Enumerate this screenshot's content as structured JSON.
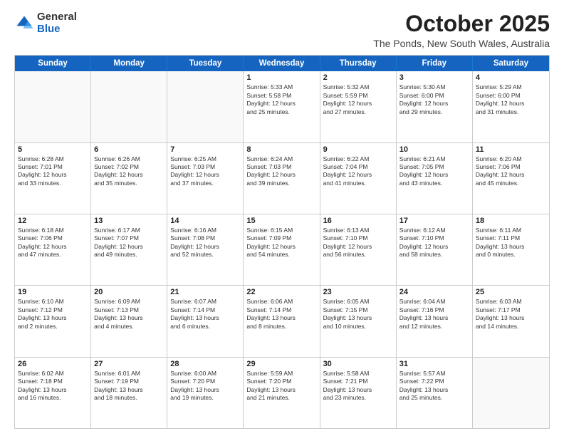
{
  "logo": {
    "general": "General",
    "blue": "Blue"
  },
  "header": {
    "month": "October 2025",
    "location": "The Ponds, New South Wales, Australia"
  },
  "weekdays": [
    "Sunday",
    "Monday",
    "Tuesday",
    "Wednesday",
    "Thursday",
    "Friday",
    "Saturday"
  ],
  "weeks": [
    [
      {
        "day": "",
        "info": ""
      },
      {
        "day": "",
        "info": ""
      },
      {
        "day": "",
        "info": ""
      },
      {
        "day": "1",
        "info": "Sunrise: 5:33 AM\nSunset: 5:58 PM\nDaylight: 12 hours\nand 25 minutes."
      },
      {
        "day": "2",
        "info": "Sunrise: 5:32 AM\nSunset: 5:59 PM\nDaylight: 12 hours\nand 27 minutes."
      },
      {
        "day": "3",
        "info": "Sunrise: 5:30 AM\nSunset: 6:00 PM\nDaylight: 12 hours\nand 29 minutes."
      },
      {
        "day": "4",
        "info": "Sunrise: 5:29 AM\nSunset: 6:00 PM\nDaylight: 12 hours\nand 31 minutes."
      }
    ],
    [
      {
        "day": "5",
        "info": "Sunrise: 6:28 AM\nSunset: 7:01 PM\nDaylight: 12 hours\nand 33 minutes."
      },
      {
        "day": "6",
        "info": "Sunrise: 6:26 AM\nSunset: 7:02 PM\nDaylight: 12 hours\nand 35 minutes."
      },
      {
        "day": "7",
        "info": "Sunrise: 6:25 AM\nSunset: 7:03 PM\nDaylight: 12 hours\nand 37 minutes."
      },
      {
        "day": "8",
        "info": "Sunrise: 6:24 AM\nSunset: 7:03 PM\nDaylight: 12 hours\nand 39 minutes."
      },
      {
        "day": "9",
        "info": "Sunrise: 6:22 AM\nSunset: 7:04 PM\nDaylight: 12 hours\nand 41 minutes."
      },
      {
        "day": "10",
        "info": "Sunrise: 6:21 AM\nSunset: 7:05 PM\nDaylight: 12 hours\nand 43 minutes."
      },
      {
        "day": "11",
        "info": "Sunrise: 6:20 AM\nSunset: 7:06 PM\nDaylight: 12 hours\nand 45 minutes."
      }
    ],
    [
      {
        "day": "12",
        "info": "Sunrise: 6:18 AM\nSunset: 7:06 PM\nDaylight: 12 hours\nand 47 minutes."
      },
      {
        "day": "13",
        "info": "Sunrise: 6:17 AM\nSunset: 7:07 PM\nDaylight: 12 hours\nand 49 minutes."
      },
      {
        "day": "14",
        "info": "Sunrise: 6:16 AM\nSunset: 7:08 PM\nDaylight: 12 hours\nand 52 minutes."
      },
      {
        "day": "15",
        "info": "Sunrise: 6:15 AM\nSunset: 7:09 PM\nDaylight: 12 hours\nand 54 minutes."
      },
      {
        "day": "16",
        "info": "Sunrise: 6:13 AM\nSunset: 7:10 PM\nDaylight: 12 hours\nand 56 minutes."
      },
      {
        "day": "17",
        "info": "Sunrise: 6:12 AM\nSunset: 7:10 PM\nDaylight: 12 hours\nand 58 minutes."
      },
      {
        "day": "18",
        "info": "Sunrise: 6:11 AM\nSunset: 7:11 PM\nDaylight: 13 hours\nand 0 minutes."
      }
    ],
    [
      {
        "day": "19",
        "info": "Sunrise: 6:10 AM\nSunset: 7:12 PM\nDaylight: 13 hours\nand 2 minutes."
      },
      {
        "day": "20",
        "info": "Sunrise: 6:09 AM\nSunset: 7:13 PM\nDaylight: 13 hours\nand 4 minutes."
      },
      {
        "day": "21",
        "info": "Sunrise: 6:07 AM\nSunset: 7:14 PM\nDaylight: 13 hours\nand 6 minutes."
      },
      {
        "day": "22",
        "info": "Sunrise: 6:06 AM\nSunset: 7:14 PM\nDaylight: 13 hours\nand 8 minutes."
      },
      {
        "day": "23",
        "info": "Sunrise: 6:05 AM\nSunset: 7:15 PM\nDaylight: 13 hours\nand 10 minutes."
      },
      {
        "day": "24",
        "info": "Sunrise: 6:04 AM\nSunset: 7:16 PM\nDaylight: 13 hours\nand 12 minutes."
      },
      {
        "day": "25",
        "info": "Sunrise: 6:03 AM\nSunset: 7:17 PM\nDaylight: 13 hours\nand 14 minutes."
      }
    ],
    [
      {
        "day": "26",
        "info": "Sunrise: 6:02 AM\nSunset: 7:18 PM\nDaylight: 13 hours\nand 16 minutes."
      },
      {
        "day": "27",
        "info": "Sunrise: 6:01 AM\nSunset: 7:19 PM\nDaylight: 13 hours\nand 18 minutes."
      },
      {
        "day": "28",
        "info": "Sunrise: 6:00 AM\nSunset: 7:20 PM\nDaylight: 13 hours\nand 19 minutes."
      },
      {
        "day": "29",
        "info": "Sunrise: 5:59 AM\nSunset: 7:20 PM\nDaylight: 13 hours\nand 21 minutes."
      },
      {
        "day": "30",
        "info": "Sunrise: 5:58 AM\nSunset: 7:21 PM\nDaylight: 13 hours\nand 23 minutes."
      },
      {
        "day": "31",
        "info": "Sunrise: 5:57 AM\nSunset: 7:22 PM\nDaylight: 13 hours\nand 25 minutes."
      },
      {
        "day": "",
        "info": ""
      }
    ]
  ]
}
